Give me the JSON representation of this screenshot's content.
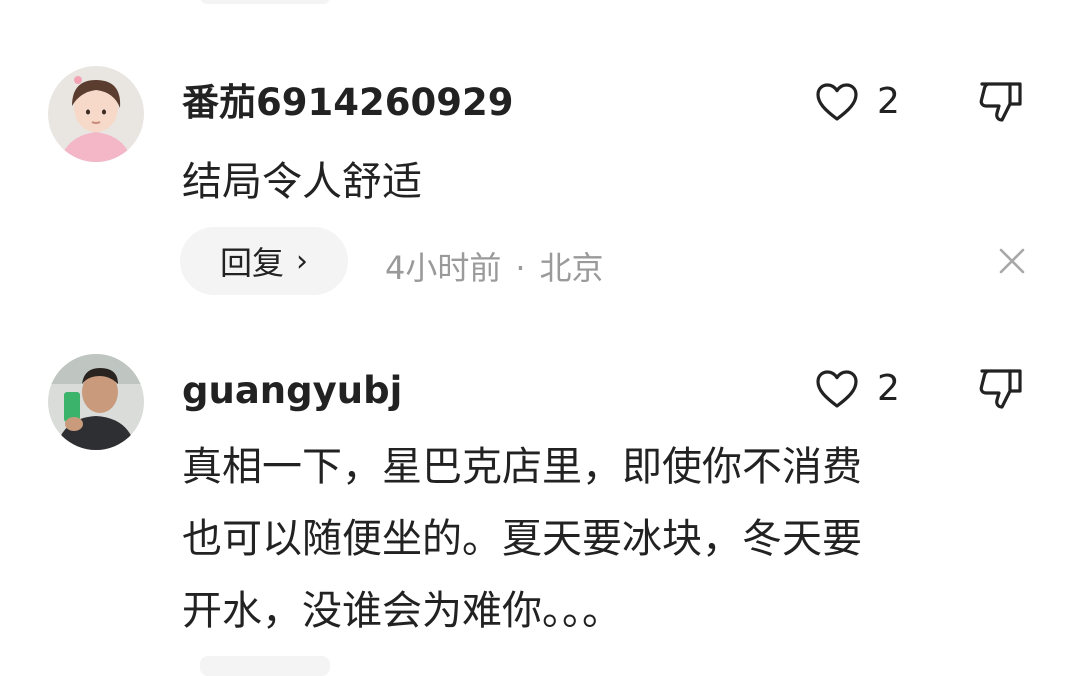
{
  "comments": [
    {
      "username": "番茄6914260929",
      "avatar_icon": "child-avatar",
      "like_icon": "heart-outline-icon",
      "like_count": "2",
      "dislike_icon": "thumbs-down-icon",
      "body_lines": [
        "结局令人舒适"
      ],
      "reply_label": "回复",
      "reply_chevron": "›",
      "time": "4小时前",
      "separator": "·",
      "location": "北京",
      "close_icon": "close-icon"
    },
    {
      "username": "guangyubj",
      "avatar_icon": "man-avatar",
      "like_icon": "heart-outline-icon",
      "like_count": "2",
      "dislike_icon": "thumbs-down-icon",
      "body_lines": [
        "真相一下，星巴克店里，即使你不消费",
        "也可以随便坐的。夏天要冰块，冬天要",
        "开水，没谁会为难你。。。"
      ]
    }
  ],
  "colors": {
    "text": "#222222",
    "meta": "#9a9a9a",
    "reply_bg": "#f4f4f4",
    "background": "#ffffff"
  }
}
